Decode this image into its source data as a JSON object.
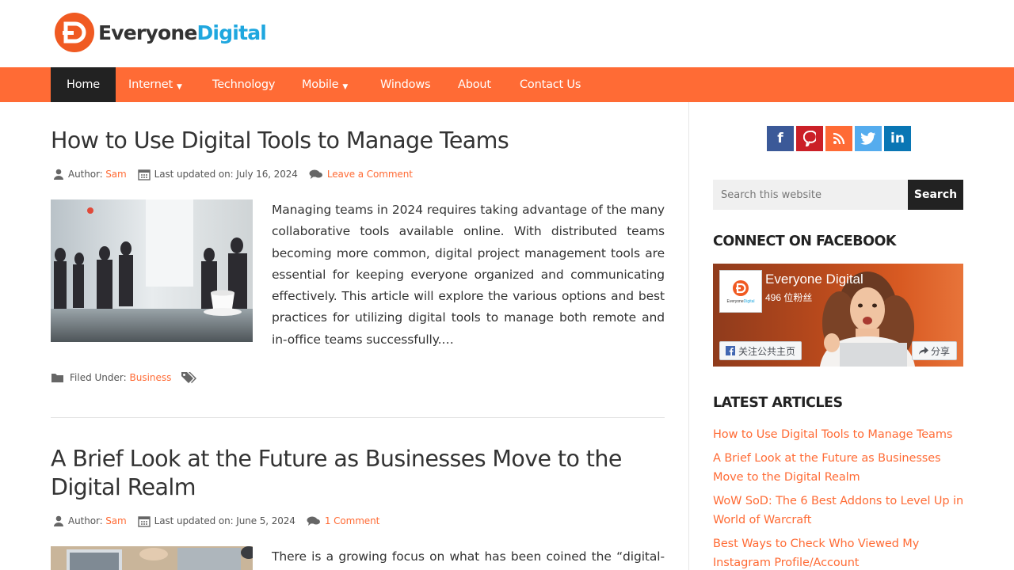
{
  "site": {
    "logo_text_1": "Everyone",
    "logo_text_2": "Digital",
    "brand_color": "#ff6b35",
    "accent_color": "#1fa7df"
  },
  "nav": {
    "items": [
      {
        "label": "Home",
        "active": true
      },
      {
        "label": "Internet",
        "has_dropdown": true
      },
      {
        "label": "Technology"
      },
      {
        "label": "Mobile",
        "has_dropdown": true
      },
      {
        "label": "Windows"
      },
      {
        "label": "About"
      },
      {
        "label": "Contact Us"
      }
    ],
    "caret": "▼"
  },
  "posts": [
    {
      "title": "How to Use Digital Tools to Manage Teams",
      "author_label": "Author:",
      "author": "Sam",
      "updated_label": "Last updated on:",
      "date": "July 16, 2024",
      "comments": "Leave a Comment",
      "excerpt": "Managing teams in 2024 requires taking advantage of the many collaborative tools available online. With distributed teams becoming more common, digital project management tools are essential for keeping everyone organized and communicating effectively. This article will explore the various options and best practices for utilizing digital tools to manage both remote and in-office teams successfully.…",
      "filed_label": "Filed Under:",
      "category": "Business"
    },
    {
      "title": "A Brief Look at the Future as Businesses Move to the Digital Realm",
      "author_label": "Author:",
      "author": "Sam",
      "updated_label": "Last updated on:",
      "date": "June 5, 2024",
      "comments": "1 Comment",
      "excerpt": "There is a growing focus on what has been coined the “digital-first”"
    }
  ],
  "sidebar": {
    "social": [
      {
        "name": "facebook",
        "glyph": "f",
        "color": "#3b5998"
      },
      {
        "name": "pinterest",
        "glyph": "P",
        "color": "#cb2027"
      },
      {
        "name": "rss",
        "glyph": "rss",
        "color": "#ff6b35"
      },
      {
        "name": "twitter",
        "glyph": "t",
        "color": "#55acee"
      },
      {
        "name": "linkedin",
        "glyph": "in",
        "color": "#0976b4"
      }
    ],
    "search_placeholder": "Search this website",
    "search_button": "Search",
    "facebook_title": "CONNECT ON FACEBOOK",
    "fb_page_name": "Everyone Digital",
    "fb_count": "496 位粉丝",
    "fb_follow": "关注公共主页",
    "fb_share": "分享",
    "latest_title": "LATEST ARTICLES",
    "latest": [
      "How to Use Digital Tools to Manage Teams",
      "A Brief Look at the Future as Businesses Move to the Digital Realm",
      "WoW SoD: The 6 Best Addons to Level Up in World of Warcraft",
      "Best Ways to Check Who Viewed My Instagram Profile/Account"
    ]
  }
}
